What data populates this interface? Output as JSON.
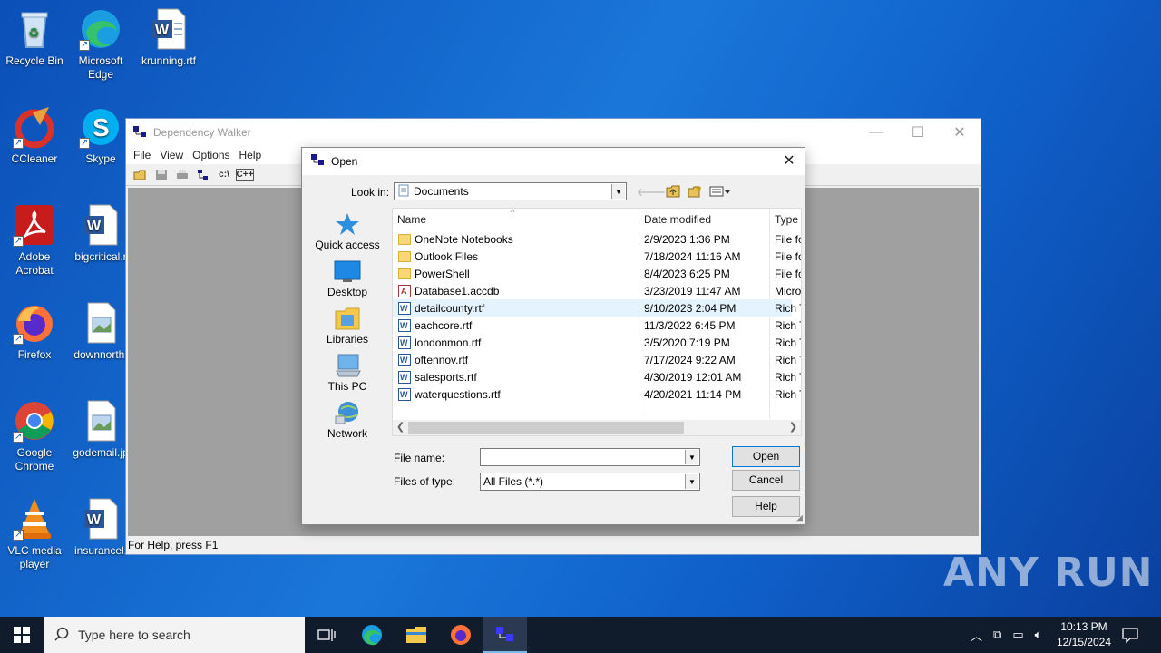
{
  "desktop": {
    "icons": [
      {
        "label": "Recycle Bin",
        "icon": "recycle-bin-icon"
      },
      {
        "label": "Microsoft Edge",
        "icon": "edge-icon"
      },
      {
        "label": "krunning.rtf",
        "icon": "word-doc-icon"
      },
      {
        "label": "CCleaner",
        "icon": "ccleaner-icon"
      },
      {
        "label": "Skype",
        "icon": "skype-icon"
      },
      {
        "label": "Adobe Acrobat",
        "icon": "acrobat-icon"
      },
      {
        "label": "bigcritical.r",
        "icon": "word-doc-icon"
      },
      {
        "label": "Firefox",
        "icon": "firefox-icon"
      },
      {
        "label": "downnorth.",
        "icon": "image-file-icon"
      },
      {
        "label": "Google Chrome",
        "icon": "chrome-icon"
      },
      {
        "label": "godemail.jp",
        "icon": "image-file-icon"
      },
      {
        "label": "VLC media player",
        "icon": "vlc-icon"
      },
      {
        "label": "insurancel.",
        "icon": "word-doc-icon"
      }
    ]
  },
  "depwalker": {
    "title": "Dependency Walker",
    "menu": [
      "File",
      "View",
      "Options",
      "Help"
    ],
    "toolbar": [
      "open-icon",
      "save-icon",
      "print-icon",
      "tree-icon",
      "c:\\",
      "C++"
    ],
    "status": "For Help, press F1"
  },
  "dialog": {
    "title": "Open",
    "look_in_label": "Look in:",
    "look_in_value": "Documents",
    "places": [
      {
        "label": "Quick access",
        "icon": "star-icon"
      },
      {
        "label": "Desktop",
        "icon": "desktop-icon"
      },
      {
        "label": "Libraries",
        "icon": "libraries-icon"
      },
      {
        "label": "This PC",
        "icon": "computer-icon"
      },
      {
        "label": "Network",
        "icon": "network-icon"
      }
    ],
    "columns": {
      "name": "Name",
      "date": "Date modified",
      "type": "Type"
    },
    "files": [
      {
        "name": "OneNote Notebooks",
        "date": "2/9/2023 1:36 PM",
        "type": "File fo",
        "kind": "folder"
      },
      {
        "name": "Outlook Files",
        "date": "7/18/2024 11:16 AM",
        "type": "File fo",
        "kind": "folder"
      },
      {
        "name": "PowerShell",
        "date": "8/4/2023 6:25 PM",
        "type": "File fo",
        "kind": "folder"
      },
      {
        "name": "Database1.accdb",
        "date": "3/23/2019 11:47 AM",
        "type": "Micro",
        "kind": "db"
      },
      {
        "name": "detailcounty.rtf",
        "date": "9/10/2023 2:04 PM",
        "type": "Rich T",
        "kind": "rtf"
      },
      {
        "name": "eachcore.rtf",
        "date": "11/3/2022 6:45 PM",
        "type": "Rich T",
        "kind": "rtf"
      },
      {
        "name": "londonmon.rtf",
        "date": "3/5/2020 7:19 PM",
        "type": "Rich T",
        "kind": "rtf"
      },
      {
        "name": "oftennov.rtf",
        "date": "7/17/2024 9:22 AM",
        "type": "Rich T",
        "kind": "rtf"
      },
      {
        "name": "salesports.rtf",
        "date": "4/30/2019 12:01 AM",
        "type": "Rich T",
        "kind": "rtf"
      },
      {
        "name": "waterquestions.rtf",
        "date": "4/20/2021 11:14 PM",
        "type": "Rich T",
        "kind": "rtf"
      }
    ],
    "file_name_label": "File name:",
    "file_name_value": "",
    "file_type_label": "Files of type:",
    "file_type_value": "All Files (*.*)",
    "open_button": "Open",
    "cancel_button": "Cancel",
    "help_button": "Help"
  },
  "taskbar": {
    "search_placeholder": "Type here to search",
    "time": "10:13 PM",
    "date": "12/15/2024"
  },
  "watermark": "ANY RUN"
}
